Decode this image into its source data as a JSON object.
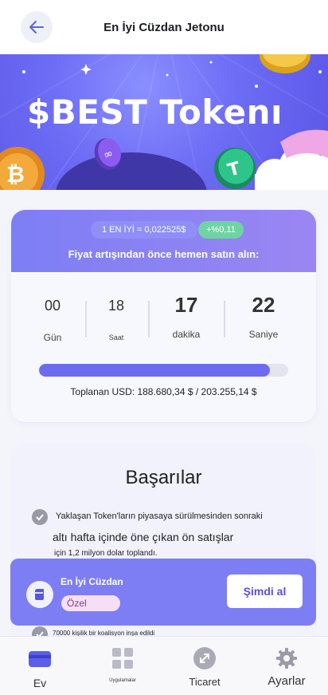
{
  "header": {
    "title": "En İyi Cüzdan Jetonu"
  },
  "banner": {
    "title": "$BEST Tokenı"
  },
  "sale": {
    "rate": "1 EN İYİ = 0,022525$",
    "change": "+%0,11",
    "subtitle": "Fiyat artışından önce hemen satın alın:",
    "timer": [
      {
        "value": "00",
        "label": "Gün"
      },
      {
        "value": "18",
        "label": "Saat"
      },
      {
        "value": "17",
        "label": "dakika"
      },
      {
        "value": "22",
        "label": "Saniye"
      }
    ],
    "progress_fraction": 0.928,
    "collected": "Toplanan USD: 188.680,34 $ / 203.255,14 $"
  },
  "achievements": {
    "title": "Başarılar",
    "line1": "Yaklaşan Token'ların piyasaya sürülmesinden sonraki",
    "line2": "altı hafta içinde öne çıkan ön satışlar",
    "line3": "için 1,2 milyon dolar toplandı.",
    "line4": "70000 kişilik bir koalisyon inşa edildi"
  },
  "wallet": {
    "name": "En İyi Cüzdan",
    "badge": "Özel",
    "buy_label": "Şimdi al"
  },
  "nav": {
    "items": [
      {
        "label": "Ev",
        "icon": "wallet-card-icon",
        "active": true
      },
      {
        "label": "Uygulamalar",
        "icon": "apps-grid-icon"
      },
      {
        "label": "Ticaret",
        "icon": "trade-arrows-icon"
      },
      {
        "label": "Ayarlar",
        "icon": "gear-icon"
      }
    ]
  },
  "colors": {
    "accent": "#6b6cf0",
    "banner": "#5b55e6",
    "change": "#6fd3a3"
  }
}
